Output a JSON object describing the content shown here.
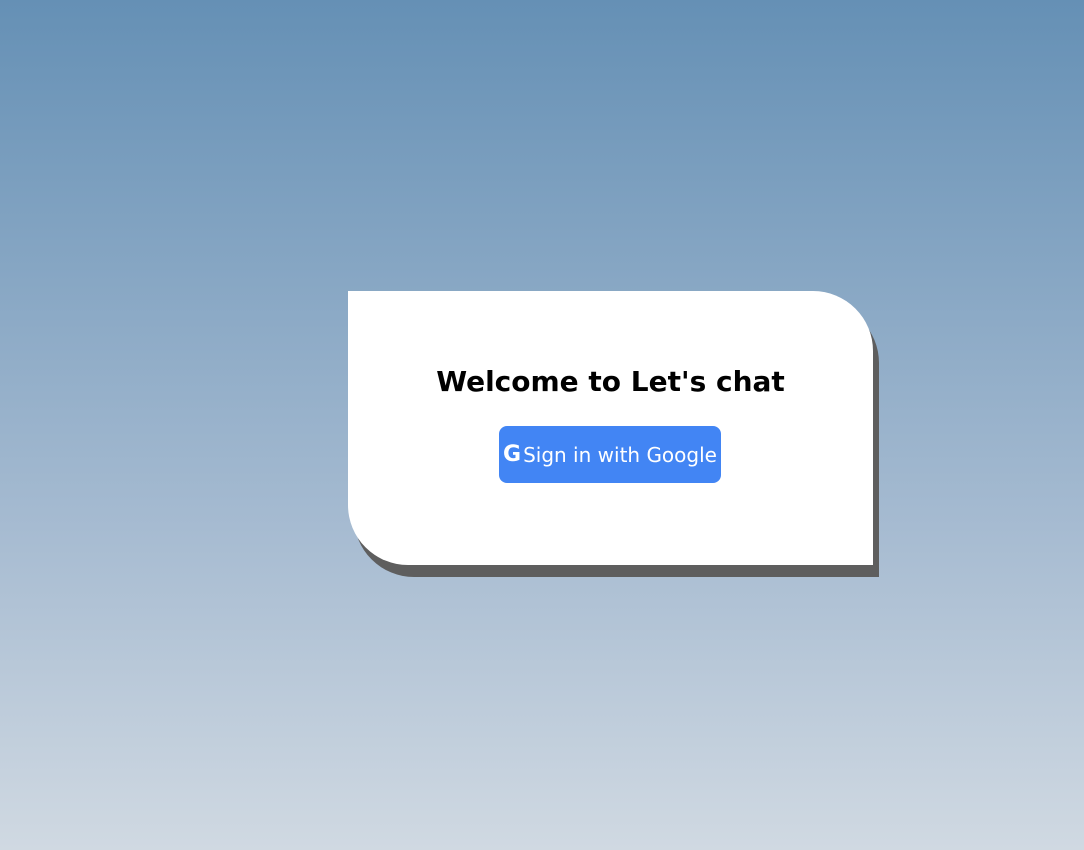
{
  "card": {
    "title": "Welcome to Let's chat"
  },
  "signin_button": {
    "icon_glyph": "G",
    "icon": "google-icon",
    "label": "Sign in with Google"
  },
  "colors": {
    "background_top": "#6590b5",
    "background_bottom": "#d0d9e2",
    "card": "#ffffff",
    "card_shadow": "#5e5e5e",
    "button": "#4285f4",
    "button_text": "#ffffff"
  }
}
